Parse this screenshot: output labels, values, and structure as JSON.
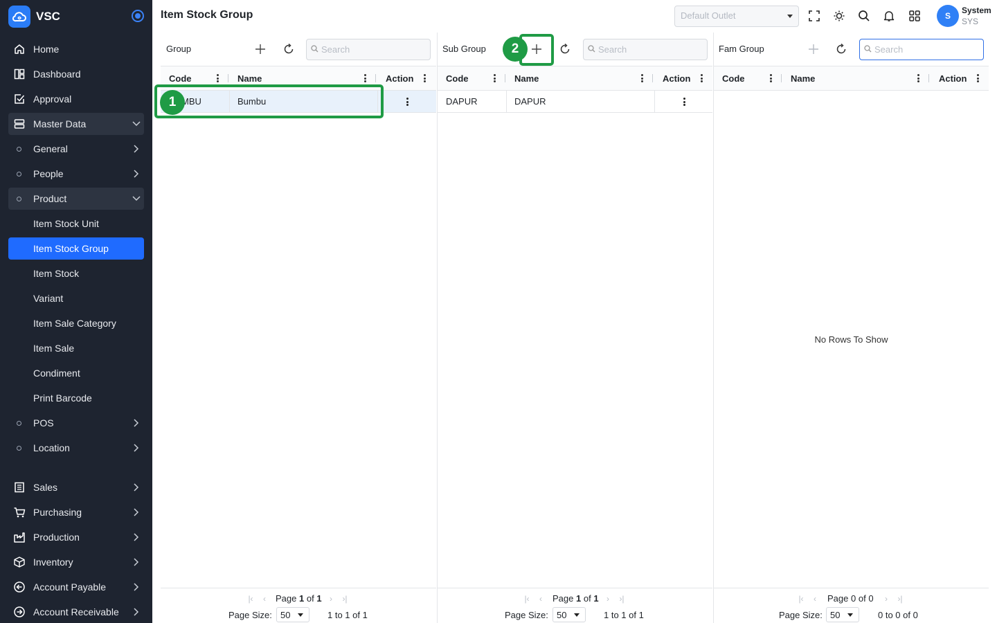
{
  "app": {
    "name": "VSC"
  },
  "sidebar": {
    "items": [
      {
        "label": "Home",
        "icon": "home-icon"
      },
      {
        "label": "Dashboard",
        "icon": "dashboard-icon"
      },
      {
        "label": "Approval",
        "icon": "approval-icon"
      },
      {
        "label": "Master Data",
        "icon": "server-icon"
      },
      {
        "label": "General"
      },
      {
        "label": "People"
      },
      {
        "label": "Product"
      },
      {
        "label": "Item Stock Unit"
      },
      {
        "label": "Item Stock Group"
      },
      {
        "label": "Item Stock"
      },
      {
        "label": "Variant"
      },
      {
        "label": "Item Sale Category"
      },
      {
        "label": "Item Sale"
      },
      {
        "label": "Condiment"
      },
      {
        "label": "Print Barcode"
      },
      {
        "label": "POS"
      },
      {
        "label": "Location"
      },
      {
        "label": "Sales",
        "icon": "receipt-icon"
      },
      {
        "label": "Purchasing",
        "icon": "cart-icon"
      },
      {
        "label": "Production",
        "icon": "factory-icon"
      },
      {
        "label": "Inventory",
        "icon": "box-icon"
      },
      {
        "label": "Account Payable",
        "icon": "arrow-left-circle-icon"
      },
      {
        "label": "Account Receivable",
        "icon": "arrow-right-circle-icon"
      }
    ]
  },
  "header": {
    "title": "Item Stock Group",
    "outlet_placeholder": "Default Outlet",
    "user": {
      "initial": "S",
      "name": "System",
      "code": "SYS"
    }
  },
  "panels": [
    {
      "title": "Group",
      "search_placeholder": "Search",
      "columns": [
        "Code",
        "Name",
        "Action"
      ],
      "rows": [
        {
          "code": "BUMBU",
          "name": "Bumbu"
        }
      ],
      "pager": {
        "page_word": "Page",
        "current": "1",
        "of_word": "of",
        "total": "1",
        "size_label": "Page Size:",
        "size": "50",
        "summary": "1 to 1 of 1"
      }
    },
    {
      "title": "Sub Group",
      "search_placeholder": "Search",
      "columns": [
        "Code",
        "Name",
        "Action"
      ],
      "rows": [
        {
          "code": "DAPUR",
          "name": "DAPUR"
        }
      ],
      "pager": {
        "page_word": "Page",
        "current": "1",
        "of_word": "of",
        "total": "1",
        "size_label": "Page Size:",
        "size": "50",
        "summary": "1 to 1 of 1"
      }
    },
    {
      "title": "Fam Group",
      "search_placeholder": "Search",
      "columns": [
        "Code",
        "Name",
        "Action"
      ],
      "rows": [],
      "empty_text": "No Rows To Show",
      "pager": {
        "page_word": "Page",
        "current": "0",
        "of_word": "of",
        "total": "0",
        "size_label": "Page Size:",
        "size": "50",
        "summary": "0 to 0 of 0"
      }
    }
  ],
  "annotations": [
    {
      "label": "1"
    },
    {
      "label": "2"
    }
  ],
  "colors": {
    "sidebar_bg": "#1e2430",
    "accent": "#1f6bff",
    "annotation": "#1f9b45",
    "selected_row": "#e8f1fb"
  }
}
